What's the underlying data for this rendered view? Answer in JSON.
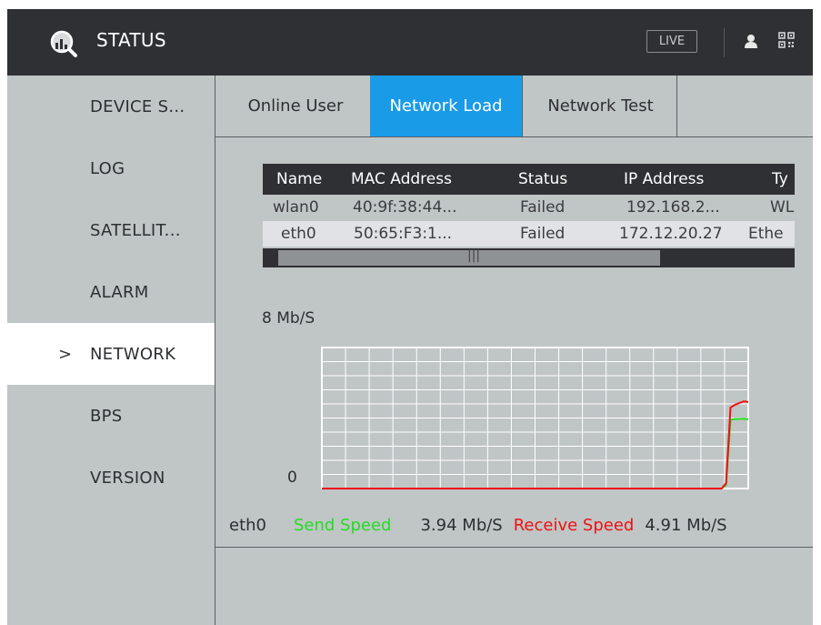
{
  "header": {
    "app_title": "STATUS",
    "live_label": "LIVE",
    "logo_icon": "magnifier-logo",
    "user_icon": "user-icon",
    "qr_icon": "qr-code-icon"
  },
  "sidebar": {
    "items": [
      {
        "label": "DEVICE S...",
        "active": false
      },
      {
        "label": "LOG",
        "active": false
      },
      {
        "label": "SATELLIT...",
        "active": false
      },
      {
        "label": "ALARM",
        "active": false
      },
      {
        "label": "NETWORK",
        "active": true
      },
      {
        "label": "BPS",
        "active": false
      },
      {
        "label": "VERSION",
        "active": false
      }
    ],
    "active_marker": ">"
  },
  "tabs": [
    {
      "label": "Online User",
      "selected": false
    },
    {
      "label": "Network Load",
      "selected": true
    },
    {
      "label": "Network Test",
      "selected": false
    }
  ],
  "table": {
    "columns": [
      "Name",
      "MAC Address",
      "Status",
      "IP Address",
      "Ty"
    ],
    "rows": [
      [
        "wlan0",
        "40:9f:38:44...",
        "Failed",
        "192.168.2...",
        "WL"
      ],
      [
        "eth0",
        "50:65:F3:1...",
        "Failed",
        "172.12.20.27",
        "Ethe"
      ]
    ],
    "scroll_grip": "|||"
  },
  "chart": {
    "scale_top": "8 Mb/S",
    "scale_bottom": "0"
  },
  "chart_data": {
    "type": "line",
    "ylim": [
      0,
      8
    ],
    "grid": true,
    "series": [
      {
        "name": "Send Speed",
        "color": "#22dd22",
        "values": [
          0,
          0,
          0,
          0,
          0,
          0,
          0,
          0,
          0,
          0,
          0,
          0,
          0,
          0,
          0,
          0,
          0,
          0,
          0,
          0,
          0,
          0,
          0,
          0,
          0,
          0,
          0,
          0,
          0,
          0,
          0,
          0,
          0,
          0,
          0,
          0,
          0,
          0,
          0,
          0,
          0,
          0,
          0,
          0,
          0,
          0,
          0,
          0,
          0,
          0,
          0,
          0,
          0,
          0,
          0,
          0,
          0,
          0,
          0,
          0,
          0,
          0,
          0,
          0,
          0,
          0,
          0,
          0,
          0,
          0,
          0,
          0,
          0,
          0,
          0,
          0,
          0,
          0,
          0,
          0,
          0,
          0,
          0,
          0,
          0,
          0,
          0,
          0,
          0,
          0,
          0,
          0.2,
          3.9,
          3.95,
          3.95,
          3.96,
          3.94
        ]
      },
      {
        "name": "Receive Speed",
        "color": "#ee1111",
        "values": [
          0,
          0,
          0,
          0,
          0,
          0,
          0,
          0,
          0,
          0,
          0,
          0,
          0,
          0,
          0,
          0,
          0,
          0,
          0,
          0,
          0,
          0,
          0,
          0,
          0,
          0,
          0,
          0,
          0,
          0,
          0,
          0,
          0,
          0,
          0,
          0,
          0,
          0,
          0,
          0,
          0,
          0,
          0,
          0,
          0,
          0,
          0,
          0,
          0,
          0,
          0,
          0,
          0,
          0,
          0,
          0,
          0,
          0,
          0,
          0,
          0,
          0,
          0,
          0,
          0,
          0,
          0,
          0,
          0,
          0,
          0,
          0,
          0,
          0,
          0,
          0,
          0,
          0,
          0,
          0,
          0,
          0,
          0,
          0,
          0,
          0,
          0,
          0,
          0,
          0,
          0,
          0.3,
          4.6,
          4.75,
          4.85,
          4.95,
          4.91
        ]
      }
    ]
  },
  "legend": {
    "interface": "eth0",
    "send_label": "Send Speed",
    "send_value": "3.94 Mb/S",
    "receive_label": "Receive Speed",
    "receive_value": "4.91 Mb/S",
    "send_color": "#22dd22",
    "receive_color": "#ee1111"
  }
}
